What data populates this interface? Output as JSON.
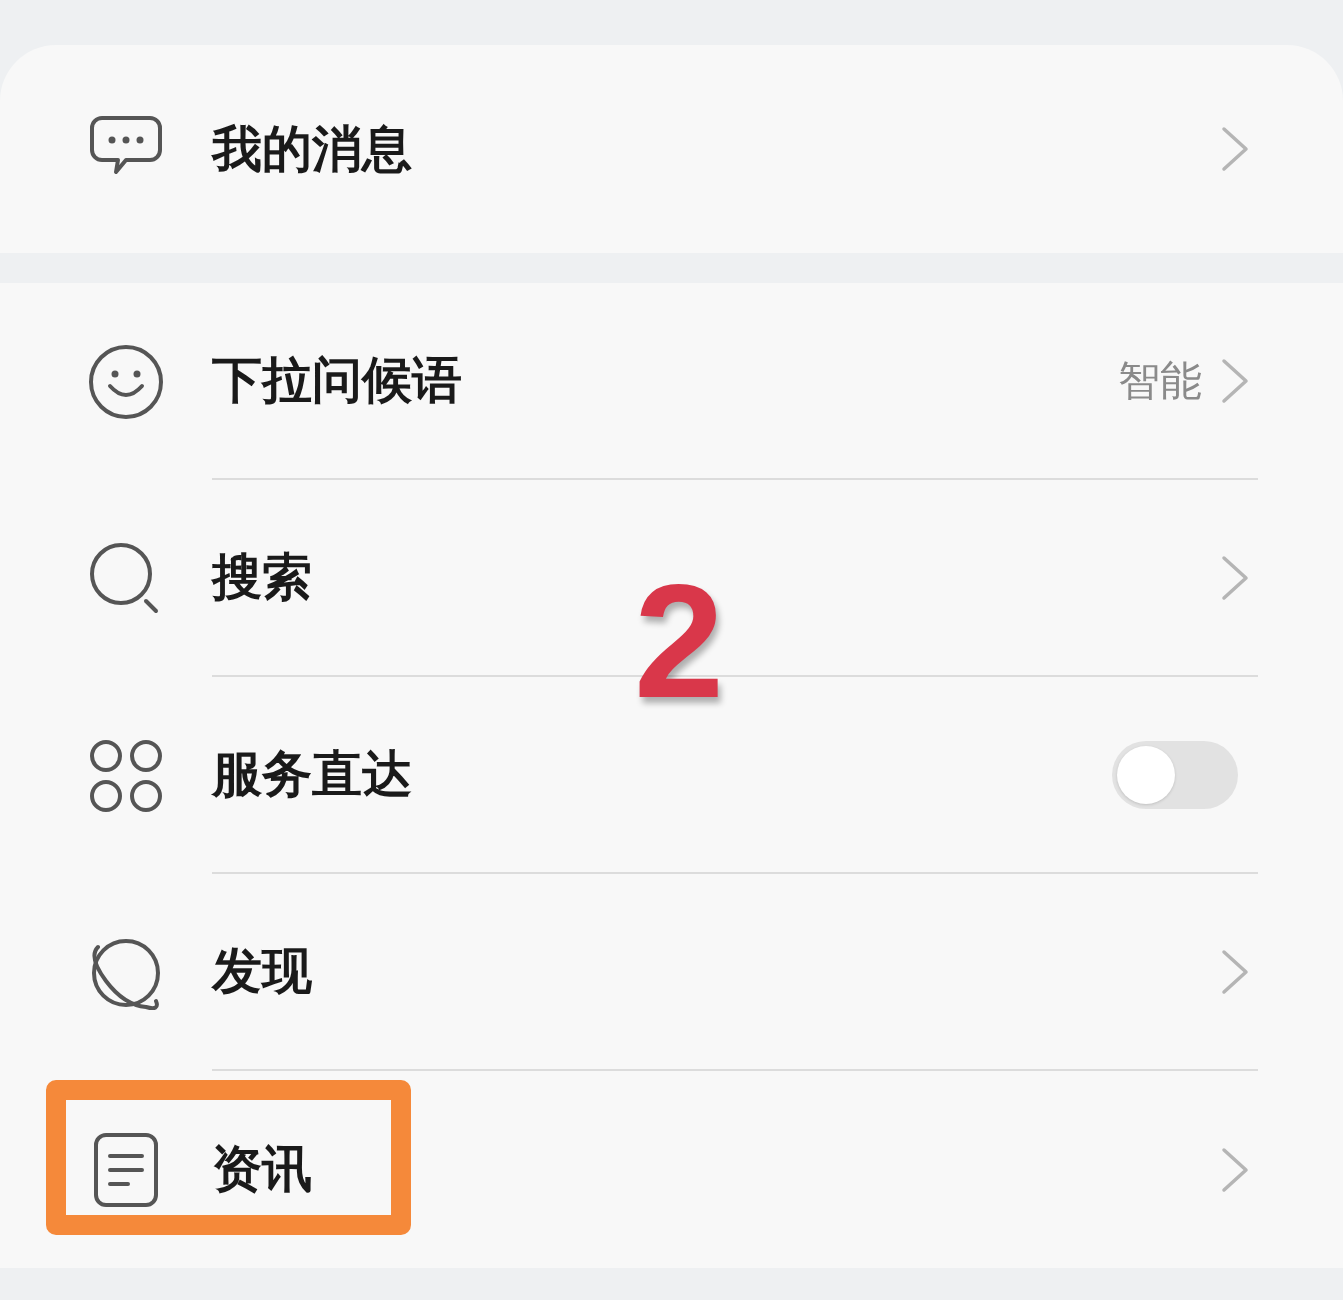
{
  "groups": [
    {
      "rows": [
        {
          "label": "我的消息",
          "kind": "link",
          "highlighted": false
        }
      ]
    },
    {
      "rows": [
        {
          "label": "下拉问候语",
          "kind": "link",
          "value": "智能",
          "highlighted": false
        },
        {
          "label": "搜索",
          "kind": "link",
          "highlighted": false
        },
        {
          "label": "服务直达",
          "kind": "toggle",
          "on": false,
          "highlighted": false
        },
        {
          "label": "发现",
          "kind": "link",
          "highlighted": false
        },
        {
          "label": "资讯",
          "kind": "link",
          "highlighted": true
        }
      ]
    }
  ],
  "step_number": "2"
}
